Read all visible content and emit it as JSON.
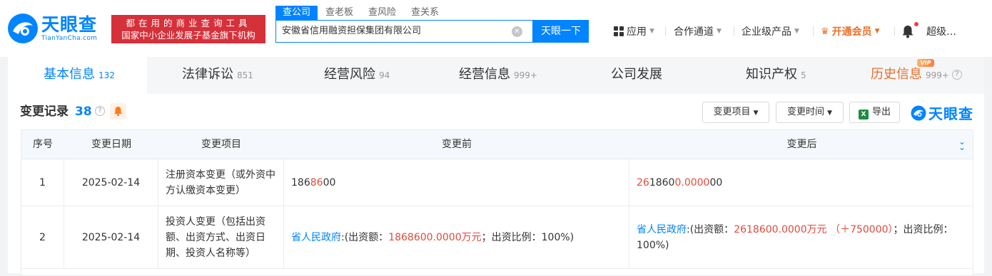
{
  "header": {
    "logo": {
      "cn": "天眼查",
      "en": "TianYanCha.com"
    },
    "slogan": {
      "line1": "都在用的商业查询工具",
      "line2": "国家中小企业发展子基金旗下机构"
    },
    "search_tabs": [
      "查公司",
      "查老板",
      "查风险",
      "查关系"
    ],
    "search_value": "安徽省信用融资担保集团有限公司",
    "search_button": "天眼一下",
    "nav": {
      "apps": "应用",
      "partners": "合作通道",
      "enterprise": "企业级产品",
      "vip": "开通会员",
      "user": "超级…"
    }
  },
  "tabs": [
    {
      "label": "基本信息",
      "count": "132"
    },
    {
      "label": "法律诉讼",
      "count": "851"
    },
    {
      "label": "经营风险",
      "count": "94"
    },
    {
      "label": "经营信息",
      "count": "999+"
    },
    {
      "label": "公司发展",
      "count": ""
    },
    {
      "label": "知识产权",
      "count": "5"
    },
    {
      "label": "历史信息",
      "count": "999+"
    }
  ],
  "vip_badge": "VIP",
  "section": {
    "title": "变更记录",
    "count": "38",
    "filter_item": "变更项目",
    "filter_time": "变更时间",
    "export": "导出",
    "brand": "天眼查"
  },
  "table": {
    "headers": [
      "序号",
      "变更日期",
      "变更项目",
      "变更前",
      "变更后"
    ],
    "rows": [
      {
        "index": "1",
        "date": "2025-02-14",
        "item": "注册资本变更（或外资中方认缴资本变更）",
        "before": {
          "p1": "186",
          "p2": "86",
          "p3": "00"
        },
        "after": {
          "p1": "26",
          "p2": "1860",
          "p3": "0.0000",
          "p4": "00"
        }
      },
      {
        "index": "2",
        "date": "2025-02-14",
        "item": "投资人变更（包括出资额、出资方式、出资日期、投资人名称等）",
        "before": {
          "name": "省人民政府",
          "label": ":(出资额：",
          "amount": "1868600.0000万元",
          "ratio": "；出资比例：100%)"
        },
        "after": {
          "name": "省人民政府",
          "label": ":(出资额：",
          "amount": "2618600.0000万元 （＋750000）",
          "ratio": "；出资比例：100%)"
        }
      }
    ]
  }
}
